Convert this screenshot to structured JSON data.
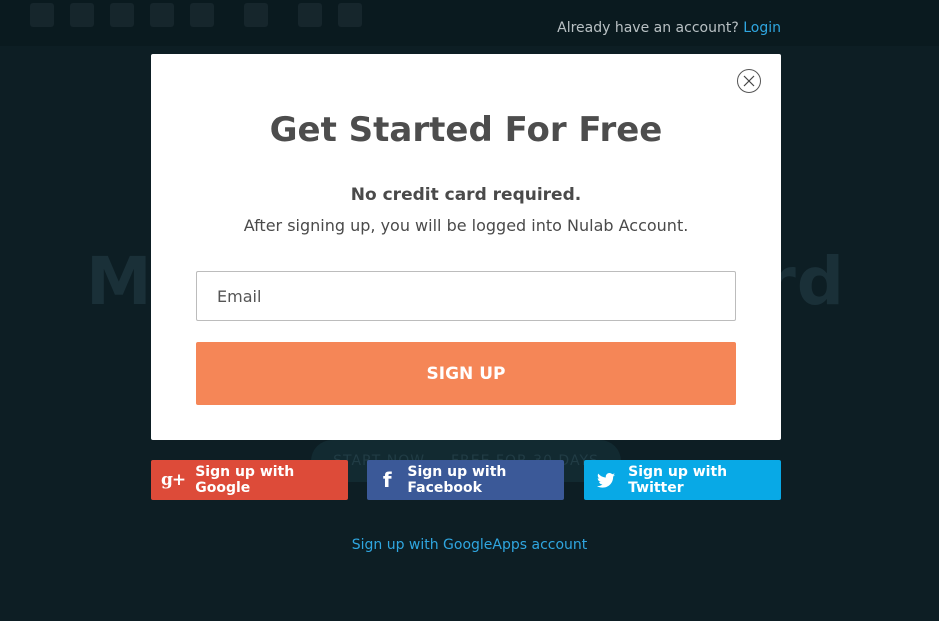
{
  "header": {
    "account_prompt": "Already have an account?",
    "login_label": "Login"
  },
  "background": {
    "headline_left": "Mo",
    "headline_right": "rd",
    "pill_text": "START NOW — FREE FOR 30 DAYS"
  },
  "modal": {
    "title": "Get Started For Free",
    "subtitle": "No credit card required.",
    "description": "After signing up, you will be logged into Nulab Account.",
    "email_placeholder": "Email",
    "email_value": "",
    "signup_label": "SIGN UP",
    "close_icon": "close-icon"
  },
  "social": {
    "google_label": "Sign up with Google",
    "google_icon": "g+",
    "facebook_label": "Sign up with Facebook",
    "facebook_icon": "f",
    "twitter_label": "Sign up with Twitter",
    "colors": {
      "google": "#dd4b39",
      "facebook": "#3b5998",
      "twitter": "#08a9e6"
    }
  },
  "googleapps_link": "Sign up with GoogleApps account",
  "colors": {
    "accent": "#f58657",
    "link": "#2fa6e0"
  }
}
